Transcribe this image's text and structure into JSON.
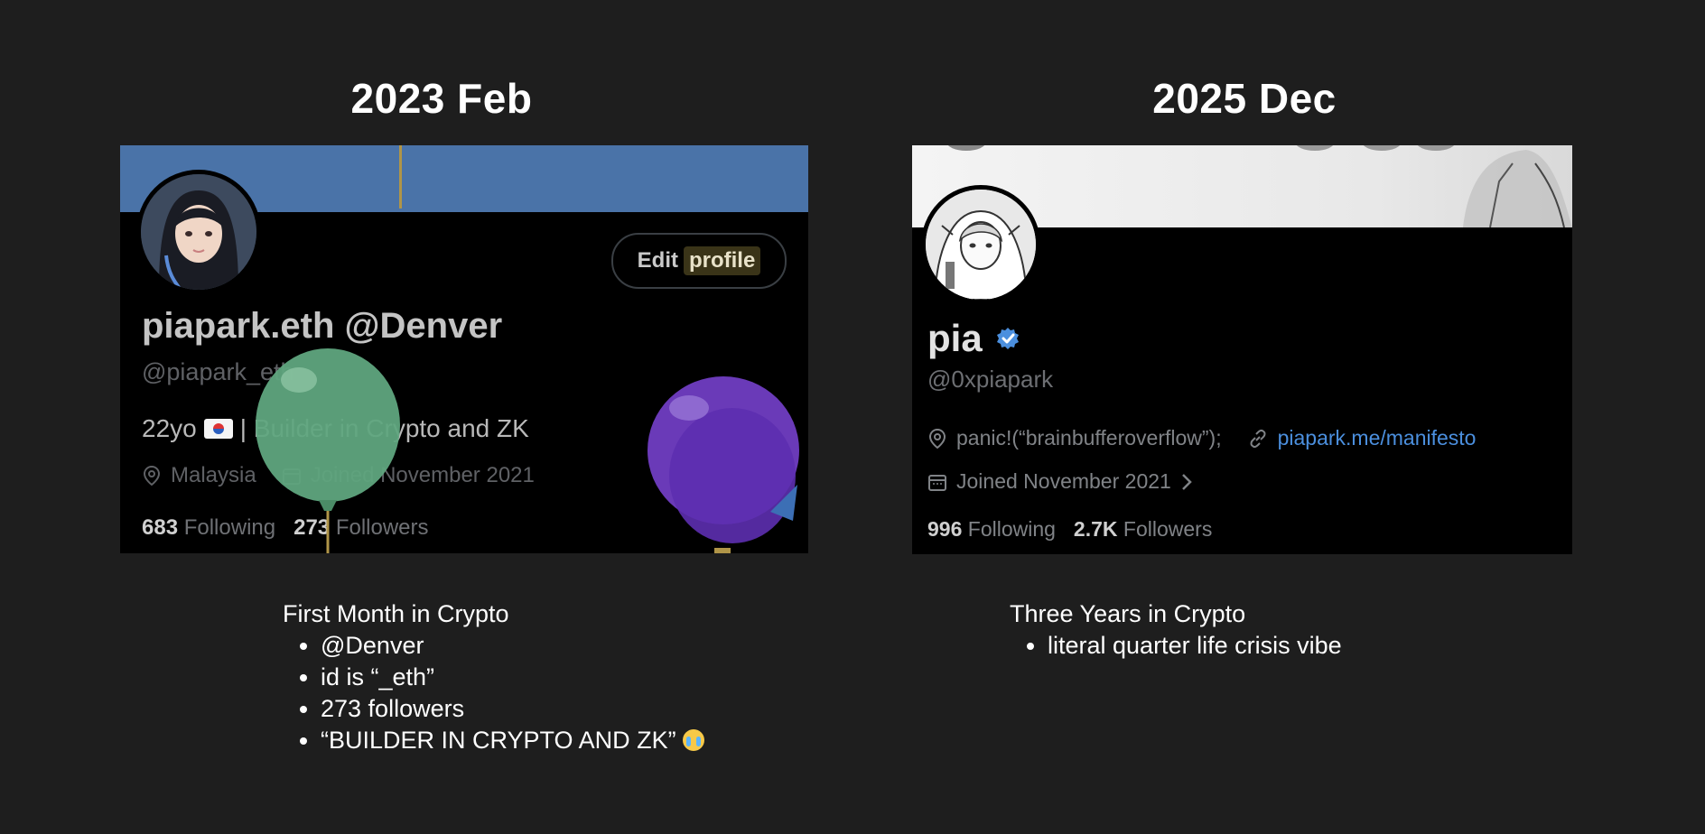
{
  "left": {
    "heading": "2023 Feb",
    "profile": {
      "edit_button_prefix": "Edit",
      "edit_button_highlight": "profile",
      "display_name": "piapark.eth @Denver",
      "handle": "@piapark_eth",
      "bio_prefix": "22yo",
      "bio_suffix": "| Builder in Crypto and ZK",
      "location": "Malaysia",
      "joined": "Joined November 2021",
      "following_count": "683",
      "following_label": "Following",
      "followers_count": "273",
      "followers_label": "Followers"
    },
    "notes": {
      "title": "First Month in Crypto",
      "items": [
        "@Denver",
        "id is “_eth”",
        "273 followers",
        "“BUILDER IN CRYPTO AND ZK”"
      ]
    }
  },
  "right": {
    "heading": "2025 Dec",
    "profile": {
      "display_name": "pia",
      "handle": "@0xpiapark",
      "location": "panic!(“brainbufferoverflow”);",
      "website": "piapark.me/manifesto",
      "joined": "Joined November 2021",
      "following_count": "996",
      "following_label": "Following",
      "followers_count": "2.7K",
      "followers_label": "Followers"
    },
    "notes": {
      "title": "Three Years in Crypto",
      "items": [
        "literal quarter life crisis vibe"
      ]
    }
  },
  "colors": {
    "background": "#1e1e1e",
    "left_banner": "#4a73a8",
    "verified_badge": "#4b8fde",
    "link": "#4b8fde",
    "green_balloon": "#5fa57e",
    "purple_balloon": "#6a3ab8"
  }
}
